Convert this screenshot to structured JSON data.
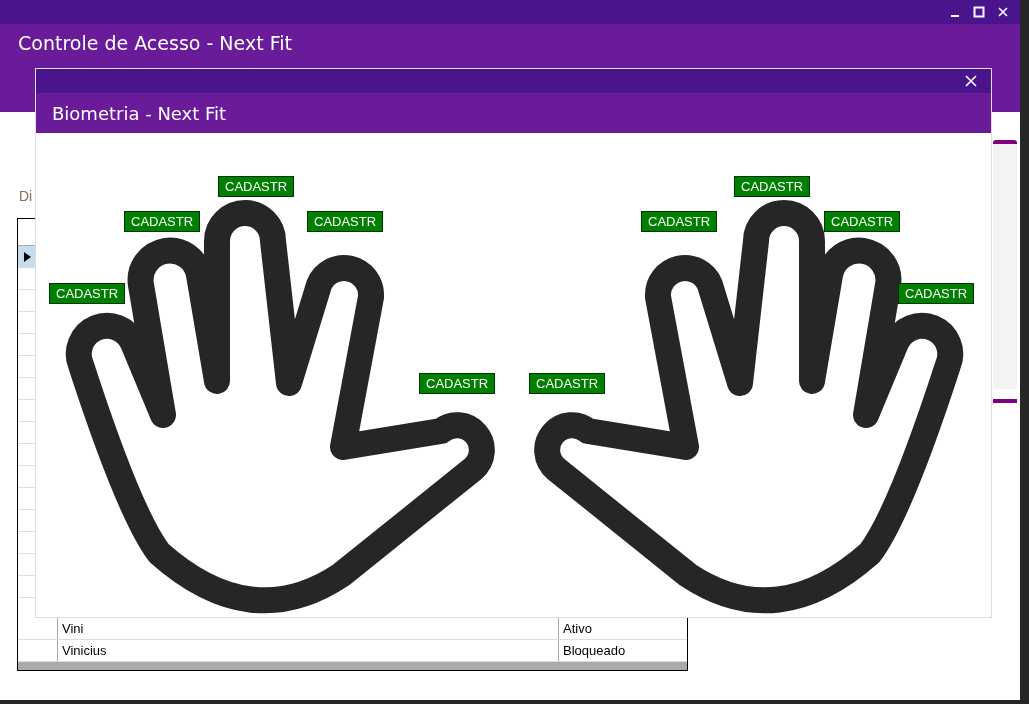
{
  "window": {
    "title": "Controle de Acesso - Next Fit"
  },
  "main": {
    "label": "Di",
    "grid": {
      "rows": [
        {
          "selected": true
        },
        {
          "selected": false,
          "name": "Vini",
          "status": "Ativo"
        },
        {
          "selected": false,
          "name": "Vinicius",
          "status": "Bloqueado"
        }
      ]
    }
  },
  "dialog": {
    "title": "Biometria - Next Fit",
    "fingers": [
      {
        "label": "CADASTR"
      },
      {
        "label": "CADASTR"
      },
      {
        "label": "CADASTR"
      },
      {
        "label": "CADASTR"
      },
      {
        "label": "CADASTR"
      },
      {
        "label": "CADASTR"
      },
      {
        "label": "CADASTR"
      },
      {
        "label": "CADASTR"
      },
      {
        "label": "CADASTR"
      },
      {
        "label": "CADASTR"
      }
    ]
  }
}
